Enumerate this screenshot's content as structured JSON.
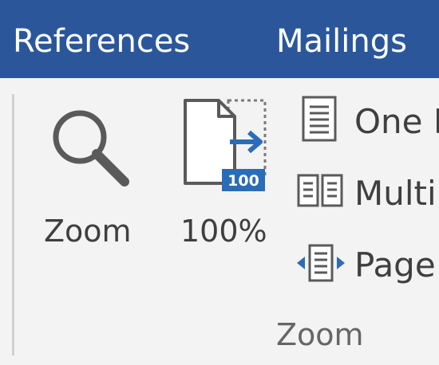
{
  "tabs": {
    "references": "References",
    "mailings": "Mailings"
  },
  "zoom_group": {
    "zoom_label": "Zoom",
    "hundred_label": "100%",
    "hundred_badge": "100",
    "one_page_label": "One P",
    "multiple_pages_label": "Multi",
    "page_width_label": "Page",
    "group_label": "Zoom"
  },
  "icons": {
    "zoom": "magnifier-icon",
    "hundred": "page-100-icon",
    "one_page": "one-page-icon",
    "multiple_pages": "multiple-pages-icon",
    "page_width": "page-width-icon"
  },
  "colors": {
    "tabbar": "#2b579a",
    "ribbon": "#f3f3f3",
    "accent": "#2b579a"
  }
}
